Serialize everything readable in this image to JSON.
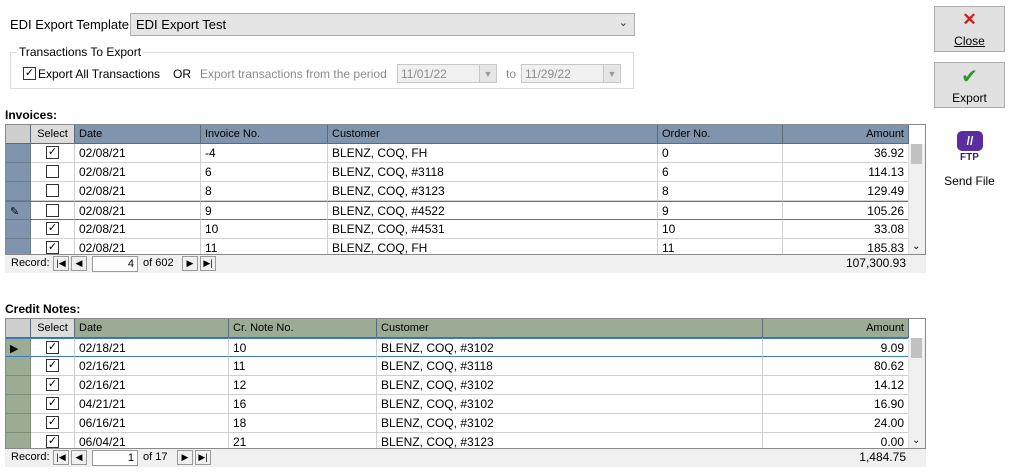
{
  "template": {
    "label": "EDI Export Template:",
    "value": "EDI Export Test"
  },
  "transactions": {
    "group_title": "Transactions To Export",
    "export_all_label": "Export All Transactions",
    "export_all_checked": true,
    "or_label": "OR",
    "period_label": "Export transactions from the period",
    "from_date": "11/01/22",
    "to_label": "to",
    "to_date": "11/29/22"
  },
  "invoices": {
    "section_label": "Invoices:",
    "columns": [
      "Select",
      "Date",
      "Invoice No.",
      "Customer",
      "Order No.",
      "Amount"
    ],
    "rows": [
      {
        "selected": true,
        "date": "02/08/21",
        "invoice_no": "-4",
        "customer": "BLENZ, COQ, FH",
        "order_no": "0",
        "amount": "36.92"
      },
      {
        "selected": false,
        "date": "02/08/21",
        "invoice_no": "6",
        "customer": "BLENZ, COQ, #3118",
        "order_no": "6",
        "amount": "114.13"
      },
      {
        "selected": false,
        "date": "02/08/21",
        "invoice_no": "8",
        "customer": "BLENZ, COQ, #3123",
        "order_no": "8",
        "amount": "129.49"
      },
      {
        "selected": false,
        "date": "02/08/21",
        "invoice_no": "9",
        "customer": "BLENZ, COQ, #4522",
        "order_no": "9",
        "amount": "105.26"
      },
      {
        "selected": true,
        "date": "02/08/21",
        "invoice_no": "10",
        "customer": "BLENZ, COQ, #4531",
        "order_no": "10",
        "amount": "33.08"
      },
      {
        "selected": true,
        "date": "02/08/21",
        "invoice_no": "11",
        "customer": "BLENZ, COQ, FH",
        "order_no": "11",
        "amount": "185.83"
      }
    ],
    "record_label": "Record:",
    "record_current": "4",
    "record_total": "of 602",
    "total_amount": "107,300.93"
  },
  "credit_notes": {
    "section_label": "Credit Notes:",
    "columns": [
      "Select",
      "Date",
      "Cr. Note No.",
      "Customer",
      "Amount"
    ],
    "rows": [
      {
        "selected": true,
        "date": "02/18/21",
        "cr_note_no": "10",
        "customer": "BLENZ, COQ, #3102",
        "amount": "9.09"
      },
      {
        "selected": true,
        "date": "02/16/21",
        "cr_note_no": "11",
        "customer": "BLENZ, COQ, #3118",
        "amount": "80.62"
      },
      {
        "selected": true,
        "date": "02/16/21",
        "cr_note_no": "12",
        "customer": "BLENZ, COQ, #3102",
        "amount": "14.12"
      },
      {
        "selected": true,
        "date": "04/21/21",
        "cr_note_no": "16",
        "customer": "BLENZ, COQ, #3102",
        "amount": "16.90"
      },
      {
        "selected": true,
        "date": "06/16/21",
        "cr_note_no": "18",
        "customer": "BLENZ, COQ, #3102",
        "amount": "24.00"
      },
      {
        "selected": true,
        "date": "06/04/21",
        "cr_note_no": "21",
        "customer": "BLENZ, COQ, #3123",
        "amount": "0.00"
      }
    ],
    "record_label": "Record:",
    "record_current": "1",
    "record_total": "of 17",
    "total_amount": "1,484.75"
  },
  "buttons": {
    "close": "Close",
    "export": "Export",
    "send_file": "Send File",
    "ftp_text": "FTP"
  },
  "colors": {
    "invoice_header": "#7f95ad",
    "credit_header": "#9cab94",
    "close_icon": "#cc1f1f",
    "export_icon": "#2e9a2e",
    "ftp_icon": "#5b2c9e"
  }
}
